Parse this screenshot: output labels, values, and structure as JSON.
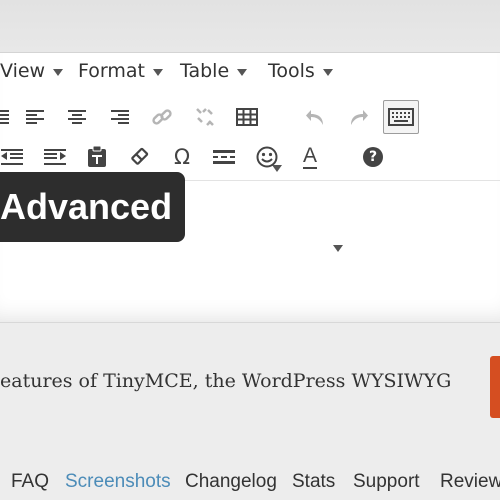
{
  "menubar": {
    "items": [
      {
        "label": "View"
      },
      {
        "label": "Format"
      },
      {
        "label": "Table"
      },
      {
        "label": "Tools"
      }
    ]
  },
  "toolbar": {
    "row1": [
      "align-left-icon",
      "align-center-icon",
      "align-right-icon",
      "link-icon",
      "unlink-icon",
      "table-icon",
      "undo-icon",
      "redo-icon",
      "keyboard-toggle-icon"
    ],
    "row2": [
      "outdent-icon",
      "indent-icon",
      "paste-as-text-icon",
      "clear-formatting-icon",
      "special-character-icon",
      "horizontal-line-icon",
      "emoticons-icon",
      "text-color-icon",
      "help-icon"
    ],
    "omega_glyph": "Ω",
    "text_color_glyph": "A",
    "help_glyph": "?"
  },
  "banner": {
    "text": "Advanced"
  },
  "plugin": {
    "description": "eatures of TinyMCE, the WordPress WYSIWYG"
  },
  "tabs": [
    {
      "label": "FAQ"
    },
    {
      "label": "Screenshots"
    },
    {
      "label": "Changelog"
    },
    {
      "label": "Stats"
    },
    {
      "label": "Support"
    },
    {
      "label": "Reviews"
    }
  ],
  "colors": {
    "accent_link": "#4c8cb8",
    "download_button": "#d54e21",
    "badge_bg": "#2d2d2d"
  }
}
